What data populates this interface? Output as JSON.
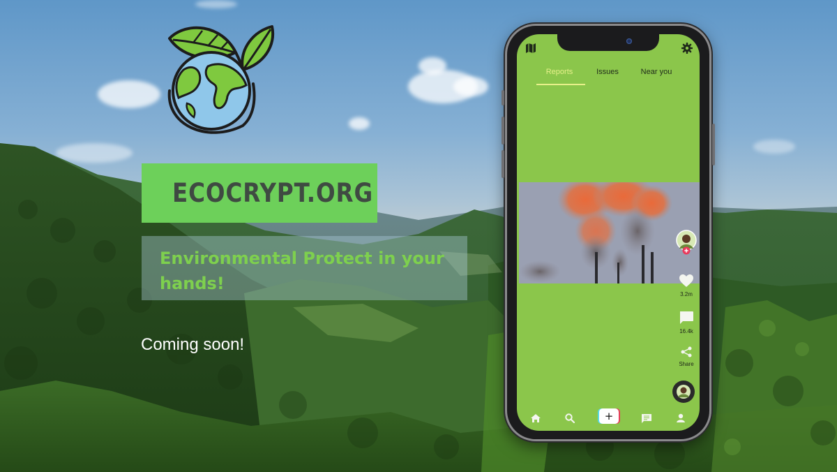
{
  "brand": {
    "name": "ECOCRYPT.ORG"
  },
  "tagline": "Environmental Protect in your hands!",
  "coming_soon": "Coming soon!",
  "app": {
    "tabs": [
      {
        "label": "Reports",
        "active": true
      },
      {
        "label": "Issues",
        "active": false
      },
      {
        "label": "Near you",
        "active": false
      }
    ],
    "actions": {
      "likes": "3.2m",
      "comments": "16.4k",
      "share": "Share"
    },
    "nav": [
      "home-icon",
      "search-icon",
      "create-button",
      "messages-icon",
      "profile-icon"
    ]
  },
  "colors": {
    "brand_box": "#6dd05a",
    "brand_text": "#3f4a42",
    "tagline_text": "#7ed04e",
    "app_background": "#8bc64b",
    "tab_active": "#e7f08a"
  }
}
